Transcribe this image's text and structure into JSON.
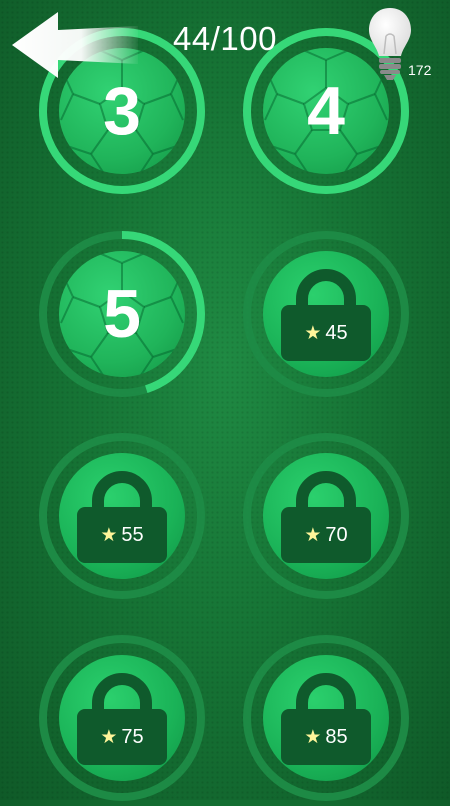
{
  "header": {
    "back_icon": "back-arrow-icon",
    "progress": "44/100",
    "hint_icon": "lightbulb-icon",
    "hint_count": "172"
  },
  "colors": {
    "background": "#167435",
    "ring_track": "#1d8a45",
    "ring_progress": "#36d878",
    "disc": "#20b45a",
    "lock": "#0f5a2c",
    "star": "#fff59a"
  },
  "levels": [
    {
      "id": "3",
      "label": "3",
      "state": "unlocked",
      "progress": 1.0
    },
    {
      "id": "4",
      "label": "4",
      "state": "unlocked",
      "progress": 1.0
    },
    {
      "id": "5",
      "label": "5",
      "state": "unlocked",
      "progress": 0.45
    },
    {
      "id": "6",
      "state": "locked",
      "star_cost": "45",
      "icon": "lock-icon"
    },
    {
      "id": "7",
      "state": "locked",
      "star_cost": "55",
      "icon": "lock-icon"
    },
    {
      "id": "8",
      "state": "locked",
      "star_cost": "70",
      "icon": "lock-icon"
    },
    {
      "id": "9",
      "state": "locked",
      "star_cost": "75",
      "icon": "lock-icon"
    },
    {
      "id": "10",
      "state": "locked",
      "star_cost": "85",
      "icon": "lock-icon"
    }
  ]
}
